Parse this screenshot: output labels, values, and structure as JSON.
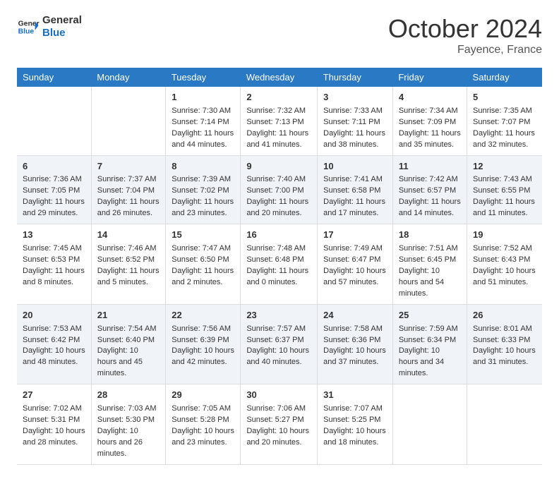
{
  "header": {
    "logo_line1": "General",
    "logo_line2": "Blue",
    "month": "October 2024",
    "location": "Fayence, France"
  },
  "weekdays": [
    "Sunday",
    "Monday",
    "Tuesday",
    "Wednesday",
    "Thursday",
    "Friday",
    "Saturday"
  ],
  "weeks": [
    [
      {
        "day": "",
        "sunrise": "",
        "sunset": "",
        "daylight": ""
      },
      {
        "day": "",
        "sunrise": "",
        "sunset": "",
        "daylight": ""
      },
      {
        "day": "1",
        "sunrise": "Sunrise: 7:30 AM",
        "sunset": "Sunset: 7:14 PM",
        "daylight": "Daylight: 11 hours and 44 minutes."
      },
      {
        "day": "2",
        "sunrise": "Sunrise: 7:32 AM",
        "sunset": "Sunset: 7:13 PM",
        "daylight": "Daylight: 11 hours and 41 minutes."
      },
      {
        "day": "3",
        "sunrise": "Sunrise: 7:33 AM",
        "sunset": "Sunset: 7:11 PM",
        "daylight": "Daylight: 11 hours and 38 minutes."
      },
      {
        "day": "4",
        "sunrise": "Sunrise: 7:34 AM",
        "sunset": "Sunset: 7:09 PM",
        "daylight": "Daylight: 11 hours and 35 minutes."
      },
      {
        "day": "5",
        "sunrise": "Sunrise: 7:35 AM",
        "sunset": "Sunset: 7:07 PM",
        "daylight": "Daylight: 11 hours and 32 minutes."
      }
    ],
    [
      {
        "day": "6",
        "sunrise": "Sunrise: 7:36 AM",
        "sunset": "Sunset: 7:05 PM",
        "daylight": "Daylight: 11 hours and 29 minutes."
      },
      {
        "day": "7",
        "sunrise": "Sunrise: 7:37 AM",
        "sunset": "Sunset: 7:04 PM",
        "daylight": "Daylight: 11 hours and 26 minutes."
      },
      {
        "day": "8",
        "sunrise": "Sunrise: 7:39 AM",
        "sunset": "Sunset: 7:02 PM",
        "daylight": "Daylight: 11 hours and 23 minutes."
      },
      {
        "day": "9",
        "sunrise": "Sunrise: 7:40 AM",
        "sunset": "Sunset: 7:00 PM",
        "daylight": "Daylight: 11 hours and 20 minutes."
      },
      {
        "day": "10",
        "sunrise": "Sunrise: 7:41 AM",
        "sunset": "Sunset: 6:58 PM",
        "daylight": "Daylight: 11 hours and 17 minutes."
      },
      {
        "day": "11",
        "sunrise": "Sunrise: 7:42 AM",
        "sunset": "Sunset: 6:57 PM",
        "daylight": "Daylight: 11 hours and 14 minutes."
      },
      {
        "day": "12",
        "sunrise": "Sunrise: 7:43 AM",
        "sunset": "Sunset: 6:55 PM",
        "daylight": "Daylight: 11 hours and 11 minutes."
      }
    ],
    [
      {
        "day": "13",
        "sunrise": "Sunrise: 7:45 AM",
        "sunset": "Sunset: 6:53 PM",
        "daylight": "Daylight: 11 hours and 8 minutes."
      },
      {
        "day": "14",
        "sunrise": "Sunrise: 7:46 AM",
        "sunset": "Sunset: 6:52 PM",
        "daylight": "Daylight: 11 hours and 5 minutes."
      },
      {
        "day": "15",
        "sunrise": "Sunrise: 7:47 AM",
        "sunset": "Sunset: 6:50 PM",
        "daylight": "Daylight: 11 hours and 2 minutes."
      },
      {
        "day": "16",
        "sunrise": "Sunrise: 7:48 AM",
        "sunset": "Sunset: 6:48 PM",
        "daylight": "Daylight: 11 hours and 0 minutes."
      },
      {
        "day": "17",
        "sunrise": "Sunrise: 7:49 AM",
        "sunset": "Sunset: 6:47 PM",
        "daylight": "Daylight: 10 hours and 57 minutes."
      },
      {
        "day": "18",
        "sunrise": "Sunrise: 7:51 AM",
        "sunset": "Sunset: 6:45 PM",
        "daylight": "Daylight: 10 hours and 54 minutes."
      },
      {
        "day": "19",
        "sunrise": "Sunrise: 7:52 AM",
        "sunset": "Sunset: 6:43 PM",
        "daylight": "Daylight: 10 hours and 51 minutes."
      }
    ],
    [
      {
        "day": "20",
        "sunrise": "Sunrise: 7:53 AM",
        "sunset": "Sunset: 6:42 PM",
        "daylight": "Daylight: 10 hours and 48 minutes."
      },
      {
        "day": "21",
        "sunrise": "Sunrise: 7:54 AM",
        "sunset": "Sunset: 6:40 PM",
        "daylight": "Daylight: 10 hours and 45 minutes."
      },
      {
        "day": "22",
        "sunrise": "Sunrise: 7:56 AM",
        "sunset": "Sunset: 6:39 PM",
        "daylight": "Daylight: 10 hours and 42 minutes."
      },
      {
        "day": "23",
        "sunrise": "Sunrise: 7:57 AM",
        "sunset": "Sunset: 6:37 PM",
        "daylight": "Daylight: 10 hours and 40 minutes."
      },
      {
        "day": "24",
        "sunrise": "Sunrise: 7:58 AM",
        "sunset": "Sunset: 6:36 PM",
        "daylight": "Daylight: 10 hours and 37 minutes."
      },
      {
        "day": "25",
        "sunrise": "Sunrise: 7:59 AM",
        "sunset": "Sunset: 6:34 PM",
        "daylight": "Daylight: 10 hours and 34 minutes."
      },
      {
        "day": "26",
        "sunrise": "Sunrise: 8:01 AM",
        "sunset": "Sunset: 6:33 PM",
        "daylight": "Daylight: 10 hours and 31 minutes."
      }
    ],
    [
      {
        "day": "27",
        "sunrise": "Sunrise: 7:02 AM",
        "sunset": "Sunset: 5:31 PM",
        "daylight": "Daylight: 10 hours and 28 minutes."
      },
      {
        "day": "28",
        "sunrise": "Sunrise: 7:03 AM",
        "sunset": "Sunset: 5:30 PM",
        "daylight": "Daylight: 10 hours and 26 minutes."
      },
      {
        "day": "29",
        "sunrise": "Sunrise: 7:05 AM",
        "sunset": "Sunset: 5:28 PM",
        "daylight": "Daylight: 10 hours and 23 minutes."
      },
      {
        "day": "30",
        "sunrise": "Sunrise: 7:06 AM",
        "sunset": "Sunset: 5:27 PM",
        "daylight": "Daylight: 10 hours and 20 minutes."
      },
      {
        "day": "31",
        "sunrise": "Sunrise: 7:07 AM",
        "sunset": "Sunset: 5:25 PM",
        "daylight": "Daylight: 10 hours and 18 minutes."
      },
      {
        "day": "",
        "sunrise": "",
        "sunset": "",
        "daylight": ""
      },
      {
        "day": "",
        "sunrise": "",
        "sunset": "",
        "daylight": ""
      }
    ]
  ]
}
